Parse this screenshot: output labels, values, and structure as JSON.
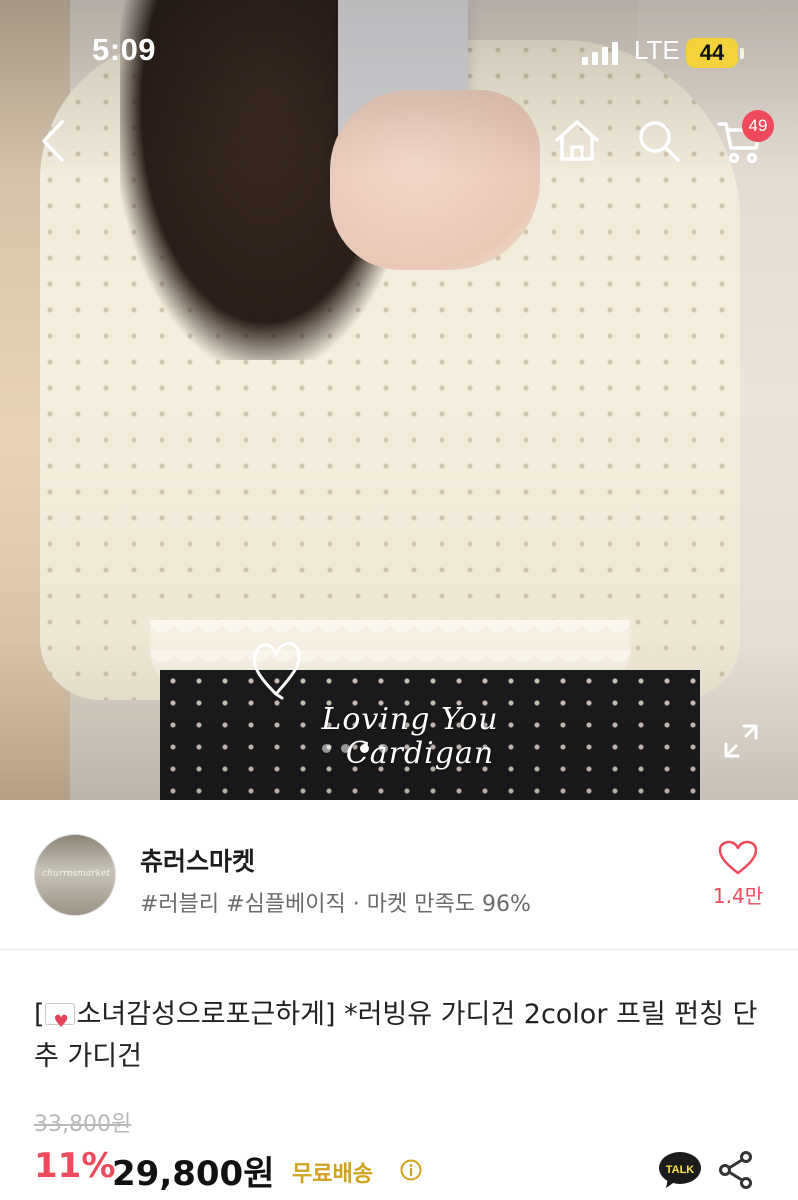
{
  "status_bar": {
    "time": "5:09",
    "network": "LTE",
    "battery": "44"
  },
  "header": {
    "cart_count": "49",
    "icons": [
      "back-icon",
      "home-icon",
      "search-icon",
      "cart-icon"
    ]
  },
  "hero": {
    "overlay_line1": "Loving You",
    "overlay_line2": "Cardigan",
    "carousel_dots": 4,
    "active_dot": 2
  },
  "store": {
    "avatar_logo": "churrosmarket",
    "name": "츄러스마켓",
    "tags": "#러블리 #심플베이직 · 마켓 만족도 96%",
    "likes": "1.4만"
  },
  "product": {
    "title_prefix": "[",
    "title_rest": "소녀감성으로포근하게] *러빙유 가디건 2color 프릴 펀칭 단추 가디건",
    "original_price": "33,800원",
    "discount": "11%",
    "price": "29,800원",
    "shipping": "무료배송",
    "talk_label": "TALK"
  },
  "colors": {
    "accent": "#ee4a5b",
    "shipping": "#d1a21d",
    "battery": "#f3d23b"
  }
}
